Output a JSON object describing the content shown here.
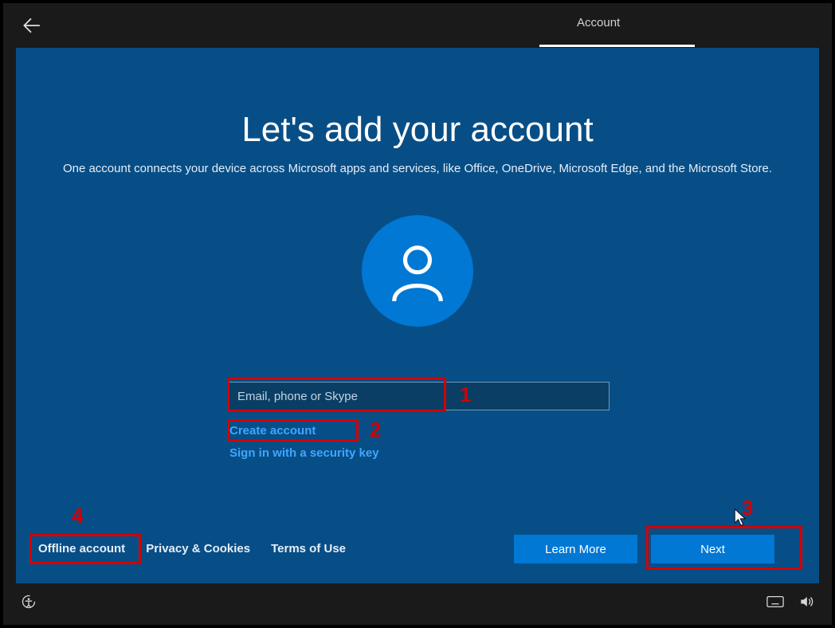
{
  "topbar": {
    "tab": "Account"
  },
  "main": {
    "title": "Let's add your account",
    "subtitle": "One account connects your device across Microsoft apps and services, like Office, OneDrive, Microsoft Edge, and the Microsoft Store.",
    "login_placeholder": "Email, phone or Skype",
    "create_account": "Create account",
    "security_key": "Sign in with a security key"
  },
  "footer": {
    "offline": "Offline account",
    "privacy": "Privacy & Cookies",
    "terms": "Terms of Use",
    "learn_more": "Learn More",
    "next": "Next"
  },
  "annotations": {
    "n1": "1",
    "n2": "2",
    "n3": "3",
    "n4": "4"
  }
}
